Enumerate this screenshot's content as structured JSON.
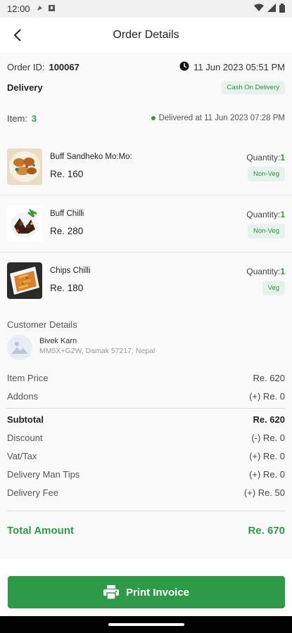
{
  "status_bar": {
    "time": "12:00"
  },
  "app_bar": {
    "title": "Order Details"
  },
  "order": {
    "id_label": "Order ID:",
    "id": "100067",
    "date": "11 Jun 2023  05:51 PM",
    "type": "Delivery",
    "payment_badge": "Cash On Delivery",
    "item_label": "Item:",
    "item_count": "3",
    "delivered_text": "Delivered at 11 Jun 2023  07:28 PM"
  },
  "items": [
    {
      "name": "Buff Sandheko Mo:Mo:",
      "price": "Re. 160",
      "qty_label": "Quantity:",
      "qty": "1",
      "tag": "Non-Veg"
    },
    {
      "name": "Buff Chilli",
      "price": "Re. 280",
      "qty_label": "Quantity:",
      "qty": "1",
      "tag": "Non-Veg"
    },
    {
      "name": "Chips Chilli",
      "price": "Re. 180",
      "qty_label": "Quantity:",
      "qty": "1",
      "tag": "Veg"
    }
  ],
  "customer": {
    "title": "Customer Details",
    "name": "Bivek Karn",
    "address": "MM5X+G2W, Damak 57217, Nepal"
  },
  "summary": {
    "item_price_label": "Item Price",
    "item_price": "Re. 620",
    "addons_label": "Addons",
    "addons": "(+) Re. 0",
    "subtotal_label": "Subtotal",
    "subtotal": "Re. 620",
    "discount_label": "Discount",
    "discount": "(-) Re. 0",
    "vat_label": "Vat/Tax",
    "vat": "(+) Re. 0",
    "tips_label": "Delivery Man Tips",
    "tips": "(+) Re. 0",
    "fee_label": "Delivery Fee",
    "fee": "(+) Re. 50",
    "total_label": "Total Amount",
    "total": "Re. 670"
  },
  "actions": {
    "print_label": "Print Invoice"
  },
  "colors": {
    "accent": "#2e9a47",
    "badge_bg": "#e7f3ea"
  }
}
